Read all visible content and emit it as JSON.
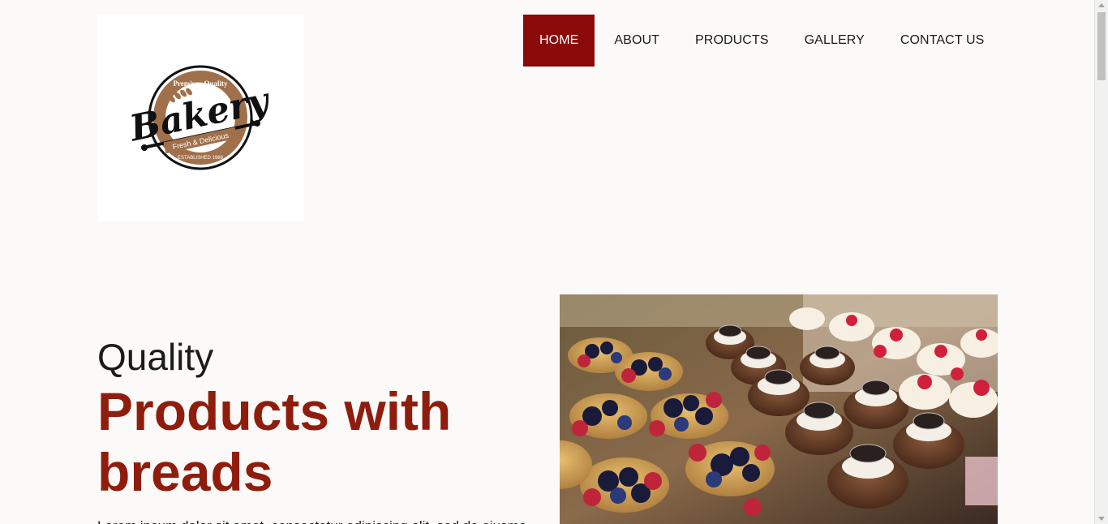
{
  "logo": {
    "top_text": "Premium Quality",
    "brand": "Bakery",
    "tagline": "Fresh & Delicious",
    "bottom_text": "ESTABLISHED 1988",
    "icon": "bakery-badge-logo",
    "ring_color": "#a0704a"
  },
  "nav": {
    "items": [
      {
        "label": "HOME",
        "active": true
      },
      {
        "label": "ABOUT",
        "active": false
      },
      {
        "label": "PRODUCTS",
        "active": false
      },
      {
        "label": "GALLERY",
        "active": false
      },
      {
        "label": "CONTACT US",
        "active": false
      }
    ],
    "active_color": "#8a0a0a"
  },
  "hero": {
    "small_title": "Quality",
    "big_title": "Products with breads",
    "description": "Lorem ipsum dolor sit amet, consectetur adipiscing elit, sed do eiusmod",
    "title_color": "#8f1d0e",
    "image": "pastry-display-photo"
  }
}
